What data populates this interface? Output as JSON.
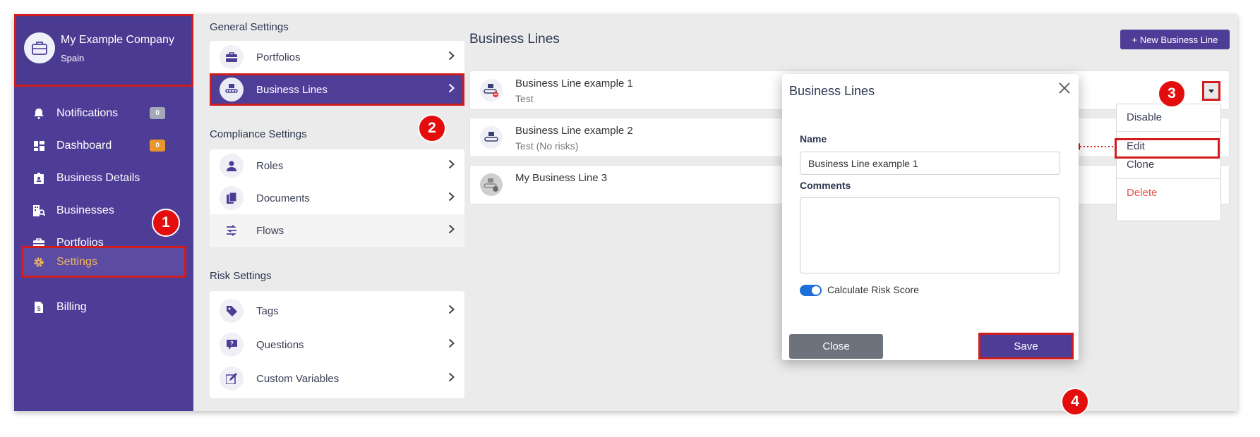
{
  "company": {
    "name": "My Example Company",
    "country": "Spain"
  },
  "sidebar": {
    "items": [
      {
        "label": "Notifications",
        "icon": "bell-icon",
        "badge": "0",
        "badge_color": "#a4a7b8"
      },
      {
        "label": "Dashboard",
        "icon": "dashboard-icon",
        "badge": "0",
        "badge_color": "#e8952a"
      },
      {
        "label": "Business Details",
        "icon": "id-badge-icon"
      },
      {
        "label": "Businesses",
        "icon": "building-search-icon"
      },
      {
        "label": "Portfolios",
        "icon": "briefcase-icon"
      },
      {
        "label": "Settings",
        "icon": "gear-icon",
        "active": true
      },
      {
        "label": "Billing",
        "icon": "invoice-icon"
      }
    ]
  },
  "settings": {
    "general_title": "General Settings",
    "general_items": [
      {
        "label": "Portfolios",
        "icon": "briefcase-icon"
      },
      {
        "label": "Business Lines",
        "icon": "conveyor-icon",
        "selected": true
      }
    ],
    "compliance_title": "Compliance Settings",
    "compliance_items": [
      {
        "label": "Roles",
        "icon": "user-icon"
      },
      {
        "label": "Documents",
        "icon": "documents-icon"
      },
      {
        "label": "Flows",
        "icon": "flow-icon"
      }
    ],
    "risk_title": "Risk Settings",
    "risk_items": [
      {
        "label": "Tags",
        "icon": "tag-icon"
      },
      {
        "label": "Questions",
        "icon": "question-icon"
      },
      {
        "label": "Custom Variables",
        "icon": "edit-variable-icon"
      }
    ]
  },
  "main": {
    "title": "Business Lines",
    "new_button": "+ New Business Line",
    "business_lines": [
      {
        "title": "Business Line example 1",
        "subtitle": "Test",
        "status": "disabled-red"
      },
      {
        "title": "Business Line example 2",
        "subtitle": "Test (No risks)",
        "status": "active"
      },
      {
        "title": "My Business Line 3",
        "subtitle": "",
        "status": "grey"
      }
    ]
  },
  "dropdown": {
    "items": [
      "Disable",
      "Edit",
      "Clone",
      "Delete"
    ],
    "delete_color": "#e5534b"
  },
  "modal": {
    "title": "Business Lines",
    "name_label": "Name",
    "name_value": "Business Line example 1",
    "comments_label": "Comments",
    "comments_value": "",
    "toggle_label": "Calculate Risk Score",
    "toggle_on": true,
    "close_button": "Close",
    "save_button": "Save"
  },
  "steps": [
    "1",
    "2",
    "3",
    "4"
  ],
  "colors": {
    "brand": "#4e3d96",
    "highlight": "#d01c1c",
    "step": "#e40d0d",
    "active_text": "#f0b75a"
  }
}
